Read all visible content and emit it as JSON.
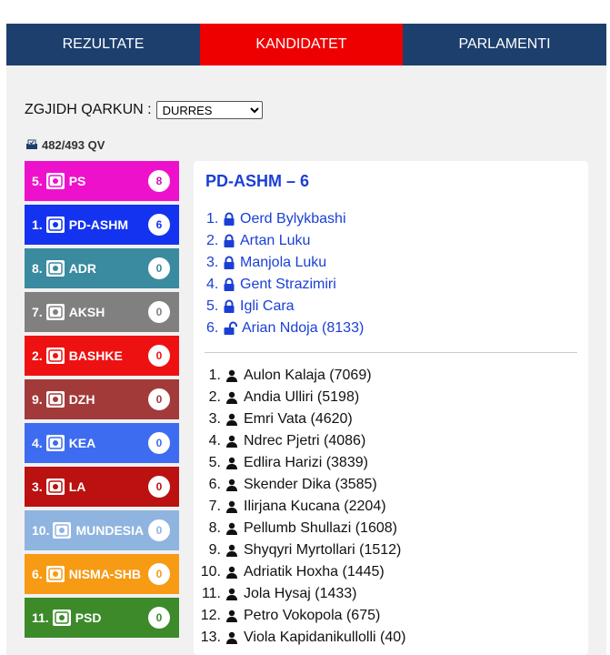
{
  "tabs": [
    {
      "label": "REZULTATE",
      "color": "#1d3f6e"
    },
    {
      "label": "KANDIDATET",
      "color": "#ee0000"
    },
    {
      "label": "PARLAMENTI",
      "color": "#1d3f6e"
    }
  ],
  "region": {
    "label": "ZGJIDH QARKUN :",
    "selected": "DURRES"
  },
  "stations": "482/493 QV",
  "parties": [
    {
      "num": "5.",
      "name": "PS",
      "seats": "8",
      "color": "#ee11cc",
      "badge_text": "#cc11aa"
    },
    {
      "num": "1.",
      "name": "PD-ASHM",
      "seats": "6",
      "color": "#1433f0",
      "badge_text": "#1433f0"
    },
    {
      "num": "8.",
      "name": "ADR",
      "seats": "0",
      "color": "#3a8aa0",
      "badge_text": "#3a8aa0"
    },
    {
      "num": "7.",
      "name": "AKSH",
      "seats": "0",
      "color": "#808080",
      "badge_text": "#808080"
    },
    {
      "num": "2.",
      "name": "BASHKE",
      "seats": "0",
      "color": "#ee1111",
      "badge_text": "#ee1111"
    },
    {
      "num": "9.",
      "name": "DZH",
      "seats": "0",
      "color": "#a33a3a",
      "badge_text": "#a33a3a"
    },
    {
      "num": "4.",
      "name": "KEA",
      "seats": "0",
      "color": "#3d6cf0",
      "badge_text": "#3d6cf0"
    },
    {
      "num": "3.",
      "name": "LA",
      "seats": "0",
      "color": "#bb1111",
      "badge_text": "#bb1111"
    },
    {
      "num": "10.",
      "name": "MUNDESIA",
      "seats": "0",
      "color": "#8fb4e0",
      "badge_text": "#8fb4e0"
    },
    {
      "num": "6.",
      "name": "NISMA-SHB",
      "seats": "0",
      "color": "#f79a14",
      "badge_text": "#f79a14"
    },
    {
      "num": "11.",
      "name": "PSD",
      "seats": "0",
      "color": "#3c8a2a",
      "badge_text": "#3c8a2a"
    }
  ],
  "selected_party": {
    "title": "PD-ASHM – 6"
  },
  "elected_candidates": [
    {
      "idx": "1.",
      "name": "Oerd Bylykbashi",
      "icon": "lock-icon"
    },
    {
      "idx": "2.",
      "name": "Artan Luku",
      "icon": "lock-icon"
    },
    {
      "idx": "3.",
      "name": "Manjola Luku",
      "icon": "lock-icon"
    },
    {
      "idx": "4.",
      "name": "Gent Strazimiri",
      "icon": "lock-icon"
    },
    {
      "idx": "5.",
      "name": "Igli Cara",
      "icon": "lock-icon"
    },
    {
      "idx": "6.",
      "name": "Arian Ndoja (8133)",
      "icon": "unlock-icon"
    }
  ],
  "other_candidates": [
    {
      "idx": "1.",
      "name": "Aulon Kalaja (7069)"
    },
    {
      "idx": "2.",
      "name": "Andia Ulliri (5198)"
    },
    {
      "idx": "3.",
      "name": "Emri Vata (4620)"
    },
    {
      "idx": "4.",
      "name": "Ndrec Pjetri (4086)"
    },
    {
      "idx": "5.",
      "name": "Edlira Harizi (3839)"
    },
    {
      "idx": "6.",
      "name": "Skender Dika (3585)"
    },
    {
      "idx": "7.",
      "name": "Ilirjana Kucana (2204)"
    },
    {
      "idx": "8.",
      "name": "Pellumb Shullazi (1608)"
    },
    {
      "idx": "9.",
      "name": "Shyqyri Myrtollari (1512)"
    },
    {
      "idx": "10.",
      "name": "Adriatik Hoxha (1445)"
    },
    {
      "idx": "11.",
      "name": "Jola Hysaj (1433)"
    },
    {
      "idx": "12.",
      "name": "Petro Vokopola (675)"
    },
    {
      "idx": "13.",
      "name": "Viola Kapidanikullolli (40)"
    }
  ]
}
